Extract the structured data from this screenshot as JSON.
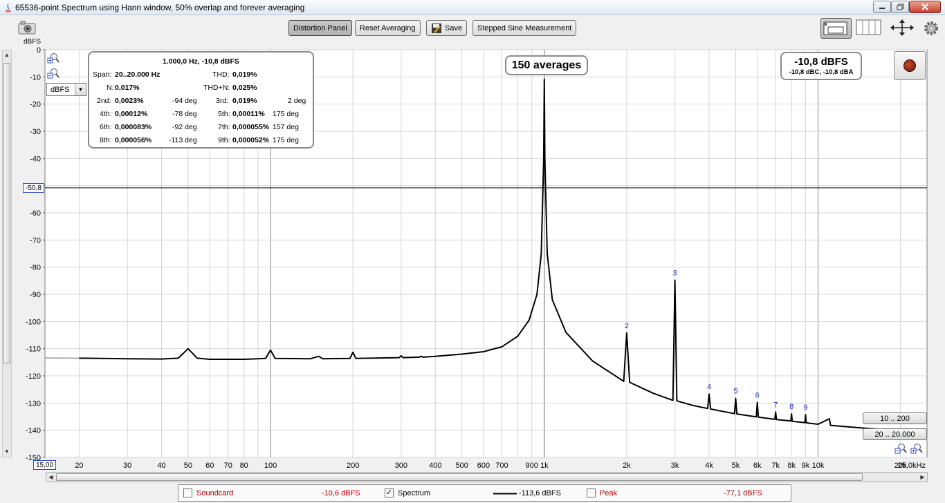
{
  "window": {
    "title": "65536-point Spectrum using Hann window, 50% overlap and forever averaging",
    "controls": [
      "minimize",
      "maximize",
      "close"
    ]
  },
  "toolbar": {
    "buttons": [
      {
        "label": "Distortion Panel",
        "pressed": true
      },
      {
        "label": "Reset Averaging",
        "pressed": false
      },
      {
        "label": "Save",
        "pressed": false
      },
      {
        "label": "Stepped Sine Measurement",
        "pressed": false
      }
    ],
    "icons": [
      "camera-icon",
      "layout-single-icon",
      "layout-columns-icon",
      "move-arrows-icon",
      "gear-icon"
    ]
  },
  "y_unit_label": "dBFS",
  "y_unit_select": "dBFS",
  "cursor_value": "-50,8",
  "x_min_box": "15,00",
  "distortion_panel": {
    "header": "1.000,0 Hz, -10,8 dBFS",
    "span_label": "Span:",
    "span_value": "20..20.000 Hz",
    "thd_label": "THD:",
    "thd_value": "0,019%",
    "n_label": "N:",
    "n_value": "0,017%",
    "thdn_label": "THD+N:",
    "thdn_value": "0,025%",
    "harmonics": [
      {
        "label": "2nd:",
        "value": "0,0023%",
        "phase": "-94 deg"
      },
      {
        "label": "3rd:",
        "value": "0,019%",
        "phase": "2 deg"
      },
      {
        "label": "4th:",
        "value": "0,00012%",
        "phase": "-78 deg"
      },
      {
        "label": "5th:",
        "value": "0,00011%",
        "phase": "175 deg"
      },
      {
        "label": "6th:",
        "value": "0,000083%",
        "phase": "-92 deg"
      },
      {
        "label": "7th:",
        "value": "0,000055%",
        "phase": "157 deg"
      },
      {
        "label": "8th:",
        "value": "0,000056%",
        "phase": "-113 deg"
      },
      {
        "label": "9th:",
        "value": "0,000052%",
        "phase": "175 deg"
      }
    ]
  },
  "averages_badge": "150 averages",
  "level_badge": {
    "main": "-10,8 dBFS",
    "sub": "-10,8 dBC, -10,8 dBA"
  },
  "range_buttons": [
    "10 .. 200",
    "20 .. 20.000"
  ],
  "legend": {
    "items": [
      {
        "label": "Soundcard",
        "checked": false,
        "value": "-10,6 dBFS",
        "color": "#b00000"
      },
      {
        "label": "Spectrum",
        "checked": true,
        "value": "-113,6 dBFS",
        "color": "#000000"
      },
      {
        "label": "Peak",
        "checked": false,
        "value": "-77,1 dBFS",
        "color": "#b00000"
      }
    ]
  },
  "colors": {
    "trace": "#000000",
    "grid": "#d4d4d4",
    "harmonic_label": "#2030c0",
    "plot_bg": "#ffffff"
  },
  "chart_data": {
    "type": "line",
    "title": "65536-point Spectrum using Hann window, 50% overlap and forever averaging",
    "xlabel": "",
    "ylabel": "dBFS",
    "xscale": "log",
    "xlim": [
      15,
      25000
    ],
    "ylim": [
      -150,
      0
    ],
    "grid": true,
    "y_ticks": [
      0,
      -10,
      -20,
      -30,
      -40,
      -50,
      -60,
      -70,
      -80,
      -90,
      -100,
      -110,
      -120,
      -130,
      -140,
      -150
    ],
    "x_tick_values": [
      20,
      30,
      40,
      50,
      60,
      70,
      80,
      100,
      200,
      300,
      400,
      500,
      600,
      700,
      900,
      1000,
      2000,
      3000,
      4000,
      5000,
      6000,
      7000,
      8000,
      9000,
      10000,
      20000,
      25000
    ],
    "x_tick_labels": [
      "20",
      "30",
      "40",
      "50",
      "60",
      "70",
      "80",
      "100",
      "200",
      "300",
      "400",
      "500",
      "600",
      "700",
      "900",
      "1k",
      "2k",
      "3k",
      "4k",
      "5k",
      "6k",
      "7k",
      "8k",
      "9k",
      "10k",
      "20k",
      "25,0kHz"
    ],
    "cursor_level": -50.8,
    "series": [
      {
        "name": "Spectrum",
        "points": [
          [
            15,
            -113.4
          ],
          [
            20,
            -113.5
          ],
          [
            30,
            -113.7
          ],
          [
            40,
            -113.8
          ],
          [
            46,
            -113.5
          ],
          [
            50,
            -110.0
          ],
          [
            54,
            -113.5
          ],
          [
            60,
            -113.9
          ],
          [
            80,
            -113.9
          ],
          [
            96,
            -113.6
          ],
          [
            100,
            -110.5
          ],
          [
            104,
            -113.6
          ],
          [
            140,
            -113.7
          ],
          [
            150,
            -112.8
          ],
          [
            155,
            -113.7
          ],
          [
            195,
            -113.6
          ],
          [
            200,
            -111.3
          ],
          [
            205,
            -113.6
          ],
          [
            295,
            -113.3
          ],
          [
            300,
            -112.6
          ],
          [
            305,
            -113.3
          ],
          [
            350,
            -113.1
          ],
          [
            355,
            -112.8
          ],
          [
            360,
            -113.1
          ],
          [
            400,
            -112.8
          ],
          [
            500,
            -112.0
          ],
          [
            600,
            -111.1
          ],
          [
            700,
            -109.3
          ],
          [
            800,
            -105.4
          ],
          [
            880,
            -99.5
          ],
          [
            940,
            -90.0
          ],
          [
            975,
            -75.0
          ],
          [
            995,
            -40.0
          ],
          [
            1000,
            -10.8
          ],
          [
            1005,
            -40.0
          ],
          [
            1025,
            -75.0
          ],
          [
            1070,
            -92.0
          ],
          [
            1200,
            -104.0
          ],
          [
            1500,
            -114.5
          ],
          [
            1950,
            -122.0
          ],
          [
            2000,
            -104.2
          ],
          [
            2050,
            -122.4
          ],
          [
            2500,
            -126.4
          ],
          [
            2950,
            -129.0
          ],
          [
            3000,
            -84.8
          ],
          [
            3050,
            -129.2
          ],
          [
            3500,
            -130.9
          ],
          [
            3950,
            -132.0
          ],
          [
            4000,
            -126.7
          ],
          [
            4050,
            -132.2
          ],
          [
            4950,
            -133.9
          ],
          [
            5000,
            -128.3
          ],
          [
            5050,
            -134.0
          ],
          [
            5950,
            -135.1
          ],
          [
            6000,
            -129.8
          ],
          [
            6050,
            -135.2
          ],
          [
            6950,
            -136.0
          ],
          [
            7000,
            -133.3
          ],
          [
            7050,
            -136.1
          ],
          [
            7950,
            -136.6
          ],
          [
            8000,
            -134.0
          ],
          [
            8050,
            -136.7
          ],
          [
            8950,
            -137.2
          ],
          [
            9000,
            -134.3
          ],
          [
            9050,
            -137.3
          ],
          [
            10000,
            -137.8
          ],
          [
            11000,
            -135.8
          ],
          [
            11100,
            -138.2
          ],
          [
            13000,
            -138.8
          ],
          [
            15000,
            -139.3
          ],
          [
            20000,
            -140.2
          ],
          [
            25000,
            -140.7
          ]
        ]
      }
    ],
    "harmonic_markers": [
      {
        "label": "2",
        "freq": 2000,
        "level": -104.2
      },
      {
        "label": "3",
        "freq": 3000,
        "level": -84.8
      },
      {
        "label": "4",
        "freq": 4000,
        "level": -126.7
      },
      {
        "label": "5",
        "freq": 5000,
        "level": -128.3
      },
      {
        "label": "6",
        "freq": 6000,
        "level": -129.8
      },
      {
        "label": "7",
        "freq": 7000,
        "level": -133.3
      },
      {
        "label": "8",
        "freq": 8000,
        "level": -134.0
      },
      {
        "label": "9",
        "freq": 9000,
        "level": -134.3
      }
    ]
  }
}
